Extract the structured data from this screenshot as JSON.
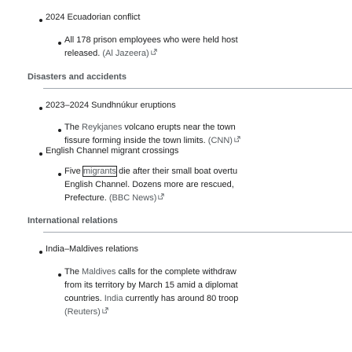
{
  "sections": [
    {
      "topic": "2024 Ecuadorian conflict",
      "items": [
        {
          "lines": [
            "All 178 prison employees who were held host",
            "released."
          ],
          "source": "(Al Jazeera)"
        }
      ]
    }
  ],
  "headings": {
    "disasters": "Disasters and accidents",
    "international": "International relations"
  },
  "disasters": [
    {
      "topic": "2023–2024 Sundhnúkur eruptions",
      "item": {
        "prefix": "The ",
        "link": "Reykjanes",
        "text1": " volcano erupts near the town",
        "line2": "fissure forming inside the town limits.",
        "source": "(CNN)"
      }
    },
    {
      "topic": "English Channel migrant crossings",
      "item": {
        "prefix": "Five ",
        "boxed": "migrants",
        "text1": " die after their small boat overtu",
        "line2a": "English Channel. Dozens more are rescued, ",
        "line3": "Prefecture.",
        "source": "(BBC News)"
      }
    }
  ],
  "international": {
    "topic": "India–Maldives relations",
    "item": {
      "prefix": "The ",
      "link": "Maldives",
      "text1": " calls for the complete withdraw",
      "line2": "from its territory by March 15 amid a diplomat",
      "line3a": "countries. ",
      "line3link": "India",
      "line3b": " currently has around 80 troop",
      "source": "(Reuters)"
    }
  },
  "icons": {
    "external": "external-link-icon"
  }
}
